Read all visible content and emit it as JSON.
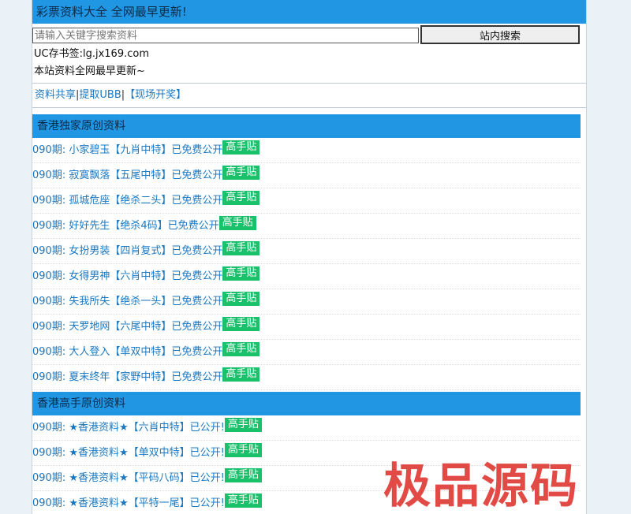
{
  "header": {
    "title": "彩票资料大全 全网最早更新!"
  },
  "search": {
    "placeholder": "请输入关键字搜索资料",
    "button_label": "站内搜索"
  },
  "info": {
    "bookmark": "UC存书签:lg.jx169.com",
    "notice": "本站资料全网最早更新~"
  },
  "nav": {
    "share": "资料共享",
    "sep1": "|",
    "ubb": "提取UBB",
    "sep2": "|",
    "live": "【现场开奖】"
  },
  "sections": [
    {
      "title": "香港独家原创资料",
      "items": [
        {
          "text": "090期: 小家碧玉【九肖中特】已免费公开",
          "badge": "高手贴"
        },
        {
          "text": "090期: 寂寞飘落【五尾中特】已免费公开",
          "badge": "高手贴"
        },
        {
          "text": "090期: 孤城危座【绝杀二头】已免费公开",
          "badge": "高手贴"
        },
        {
          "text": "090期: 好好先生【绝杀4码】已免费公开",
          "badge": "高手贴"
        },
        {
          "text": "090期: 女扮男装【四肖复式】已免费公开",
          "badge": "高手贴"
        },
        {
          "text": "090期: 女得男神【六肖中特】已免费公开",
          "badge": "高手贴"
        },
        {
          "text": "090期: 失我所失【绝杀一头】已免费公开",
          "badge": "高手贴"
        },
        {
          "text": "090期: 天罗地网【六尾中特】已免费公开",
          "badge": "高手贴"
        },
        {
          "text": "090期: 大人登入【单双中特】已免费公开",
          "badge": "高手贴"
        },
        {
          "text": "090期: 夏末终年【家野中特】已免费公开",
          "badge": "高手贴"
        }
      ]
    },
    {
      "title": "香港高手原创资料",
      "items": [
        {
          "text": "090期: ★香港资料★【六肖中特】已公开!",
          "badge": "高手贴"
        },
        {
          "text": "090期: ★香港资料★【单双中特】已公开!",
          "badge": "高手贴"
        },
        {
          "text": "090期: ★香港资料★【平码八码】已公开!",
          "badge": "高手贴"
        },
        {
          "text": "090期: ★香港资料★【平特一尾】已公开!",
          "badge": "高手贴"
        }
      ]
    }
  ],
  "watermark": "极品源码"
}
